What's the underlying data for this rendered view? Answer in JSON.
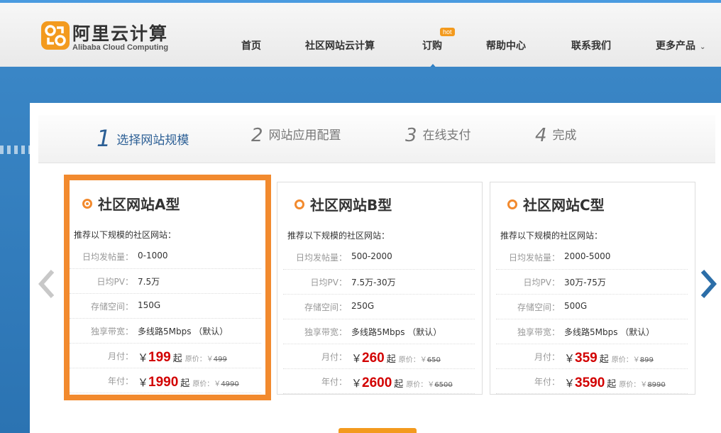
{
  "logo": {
    "cn": "阿里云计算",
    "en": "Alibaba Cloud Computing"
  },
  "nav": {
    "items": [
      {
        "label": "首页"
      },
      {
        "label": "社区网站云计算"
      },
      {
        "label": "订购"
      },
      {
        "label": "帮助中心"
      },
      {
        "label": "联系我们"
      },
      {
        "label": "更多产品"
      }
    ],
    "hot_badge": "hot"
  },
  "steps": [
    {
      "num": "1",
      "label": "选择网站规模"
    },
    {
      "num": "2",
      "label": "网站应用配置"
    },
    {
      "num": "3",
      "label": "在线支付"
    },
    {
      "num": "4",
      "label": "完成"
    }
  ],
  "labels": {
    "recommend": "推荐以下规模的社区网站：",
    "posts": "日均发帖量：",
    "pv": "日均PV：",
    "storage": "存储空间：",
    "bandwidth": "独享带宽：",
    "monthly": "月付：",
    "yearly": "年付：",
    "yen": "￥",
    "qi": "起",
    "orig": "原价：￥"
  },
  "plans": [
    {
      "name": "社区网站A型",
      "posts": "0-1000",
      "pv": "7.5万",
      "storage": "150G",
      "bandwidth": "多线路5Mbps （默认）",
      "monthly": "199",
      "monthly_orig": "499",
      "yearly": "1990",
      "yearly_orig": "4990",
      "selected": true
    },
    {
      "name": "社区网站B型",
      "posts": "500-2000",
      "pv": "7.5万-30万",
      "storage": "250G",
      "bandwidth": "多线路5Mbps （默认）",
      "monthly": "260",
      "monthly_orig": "650",
      "yearly": "2600",
      "yearly_orig": "6500",
      "selected": false
    },
    {
      "name": "社区网站C型",
      "posts": "2000-5000",
      "pv": "30万-75万",
      "storage": "500G",
      "bandwidth": "多线路5Mbps （默认）",
      "monthly": "359",
      "monthly_orig": "899",
      "yearly": "3590",
      "yearly_orig": "8990",
      "selected": false
    }
  ],
  "colors": {
    "accent": "#f28a2e",
    "price": "#d20000",
    "brand_blue": "#2c5f95"
  }
}
